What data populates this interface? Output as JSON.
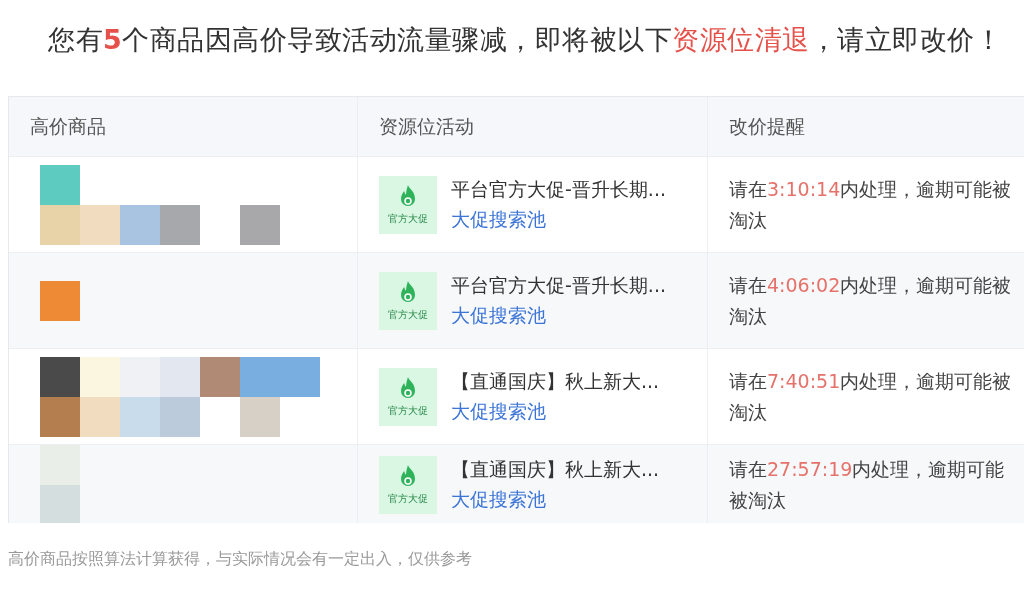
{
  "headline": [
    {
      "text": "您有",
      "highlight": false
    },
    {
      "text": "5",
      "highlight": true,
      "bold": true
    },
    {
      "text": "个商品因高价导致活动流量骤减，即将被以下",
      "highlight": false
    },
    {
      "text": "资源位清退",
      "highlight": true,
      "bold": false
    },
    {
      "text": "，请立即改价！",
      "highlight": false
    }
  ],
  "table": {
    "columns": [
      "高价商品",
      "资源位活动",
      "改价提醒"
    ],
    "rows": [
      {
        "activity": {
          "badge": "官方大促",
          "title": "平台官方大促-晋升长期...",
          "link": "大促搜索池"
        },
        "reminder": {
          "prefix": "请在",
          "time": "3:10:14",
          "suffix": "内处理，逾期可能被淘汰"
        }
      },
      {
        "activity": {
          "badge": "官方大促",
          "title": "平台官方大促-晋升长期...",
          "link": "大促搜索池"
        },
        "reminder": {
          "prefix": "请在",
          "time": "4:06:02",
          "suffix": "内处理，逾期可能被淘汰"
        }
      },
      {
        "activity": {
          "badge": "官方大促",
          "title": "【直通国庆】秋上新大...",
          "link": "大促搜索池"
        },
        "reminder": {
          "prefix": "请在",
          "time": "7:40:51",
          "suffix": "内处理，逾期可能被淘汰"
        }
      },
      {
        "activity": {
          "badge": "官方大促",
          "title": "【直通国庆】秋上新大...",
          "link": "大促搜索池"
        },
        "reminder": {
          "prefix": "请在",
          "time": "27:57:19",
          "suffix": "内处理，逾期可能被淘汰"
        }
      }
    ]
  },
  "footnote": "高价商品按照算法计算获得，与实际情况会有一定出入，仅供参考"
}
